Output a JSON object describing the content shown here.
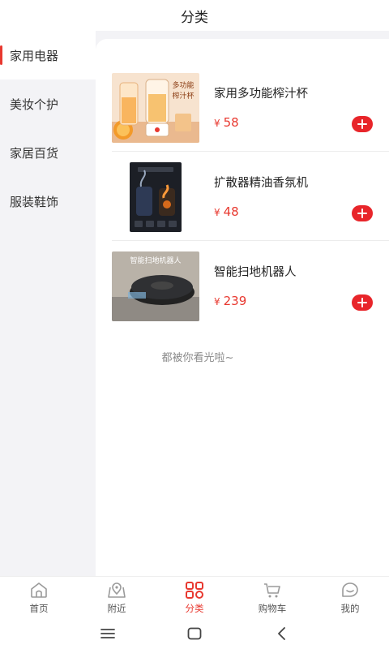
{
  "header": {
    "title": "分类"
  },
  "sidebar": {
    "items": [
      {
        "label": "家用电器",
        "active": true
      },
      {
        "label": "美妆个护",
        "active": false
      },
      {
        "label": "家居百货",
        "active": false
      },
      {
        "label": "服装鞋饰",
        "active": false
      }
    ]
  },
  "products": [
    {
      "name": "家用多功能榨汁杯",
      "currency": "¥",
      "price": "58",
      "image_icon": "juicer-cup-image",
      "image_text_1": "多功能",
      "image_text_2": "榨汁杯"
    },
    {
      "name": "扩散器精油香氛机",
      "currency": "¥",
      "price": "48",
      "image_icon": "aroma-diffuser-image",
      "image_text_1": ""
    },
    {
      "name": "智能扫地机器人",
      "currency": "¥",
      "price": "239",
      "image_icon": "robot-vacuum-image",
      "image_text_1": "智能扫地机器人"
    }
  ],
  "end_text": "都被你看光啦~",
  "tabbar": {
    "items": [
      {
        "label": "首页",
        "icon": "home-icon",
        "active": false
      },
      {
        "label": "附近",
        "icon": "map-pin-icon",
        "active": false
      },
      {
        "label": "分类",
        "icon": "category-grid-icon",
        "active": true
      },
      {
        "label": "购物车",
        "icon": "cart-icon",
        "active": false
      },
      {
        "label": "我的",
        "icon": "profile-icon",
        "active": false
      }
    ]
  },
  "colors": {
    "accent": "#e8382f",
    "sidebar_bg": "#f3f3f6"
  }
}
